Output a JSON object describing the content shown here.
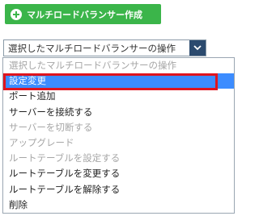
{
  "create_button": {
    "label": "マルチロードバランサー作成",
    "icon": "plus-circle-icon",
    "color": "#3bb54a"
  },
  "operation_select": {
    "selected_value": "選択したマルチロードバランサーの操作",
    "arrow_icon": "chevron-down-icon",
    "arrow_color": "#2b4a6e"
  },
  "dropdown": {
    "highlight_color": "#3c8cff",
    "annotation_color": "#e0141e",
    "options": [
      {
        "label": "選択したマルチロードバランサーの操作",
        "enabled": false,
        "highlighted": false
      },
      {
        "label": "設定変更",
        "enabled": true,
        "highlighted": true
      },
      {
        "label": "ポート追加",
        "enabled": true,
        "highlighted": false
      },
      {
        "label": "サーバーを接続する",
        "enabled": true,
        "highlighted": false
      },
      {
        "label": "サーバーを切断する",
        "enabled": false,
        "highlighted": false
      },
      {
        "label": "アップグレード",
        "enabled": false,
        "highlighted": false
      },
      {
        "label": "ルートテーブルを設定する",
        "enabled": false,
        "highlighted": false
      },
      {
        "label": "ルートテーブルを変更する",
        "enabled": true,
        "highlighted": false
      },
      {
        "label": "ルートテーブルを解除する",
        "enabled": true,
        "highlighted": false
      },
      {
        "label": "削除",
        "enabled": true,
        "highlighted": false
      }
    ]
  }
}
